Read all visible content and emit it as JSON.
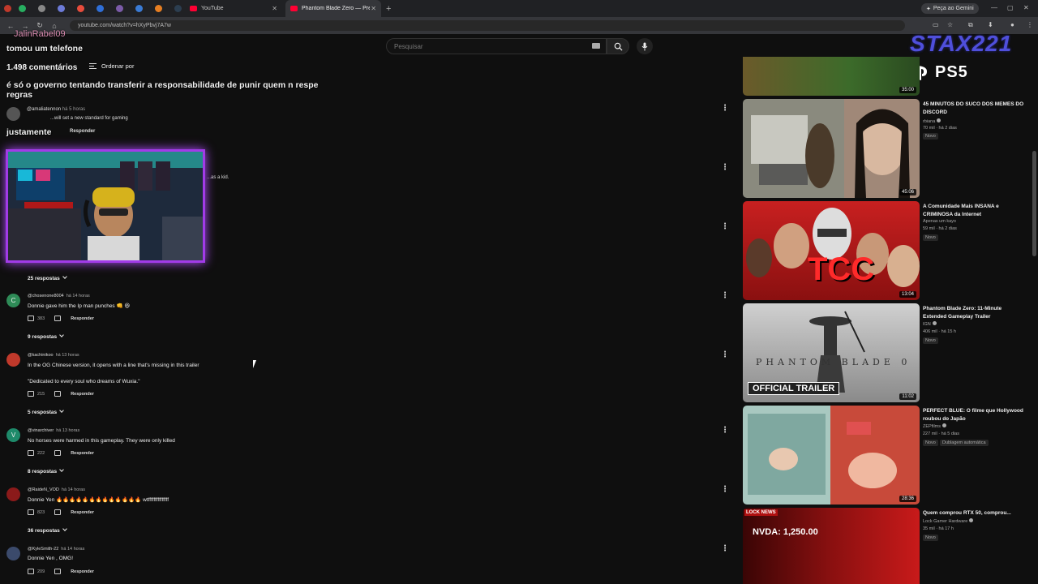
{
  "browser": {
    "tabs": [
      {
        "title": "YouTube",
        "active": false
      },
      {
        "title": "Phantom Blade Zero — Pre-Or",
        "active": true
      }
    ],
    "gemini_label": "Peça ao Gemini",
    "url": "youtube.com/watch?v=hXyPbvj7A7w",
    "new_tab": "+"
  },
  "header": {
    "search_placeholder": "Pesquisar"
  },
  "comments_header": {
    "count": "1.498 comentários",
    "sort_label": "Ordenar por"
  },
  "overlay": {
    "chat_name": "JalinRabel09",
    "chat_lines": [
      "tomou um telefone",
      "é só o governo tentando transferir a responsabilidade de punir quem n respe",
      "regras",
      "justamente"
    ],
    "ghost_author": "@amaliatennon",
    "ghost_time": "há 5 horas",
    "ghost_text": "...will set a new standard for gaming",
    "ghost_reply": "Responder",
    "ghost_kid": "...as a kid.",
    "logo_text": "STAX221",
    "console_text": "PS5"
  },
  "comments": [
    {
      "replies": "25 respostas"
    },
    {
      "author": "@chosenone8004",
      "time": "há 14 horas",
      "text": "Donnie gave him the Ip man punches 👊 😆",
      "likes": "383",
      "reply": "Responder",
      "replies": "9 respostas",
      "avatar_color": "#2e8b57",
      "avatar_letter": "C"
    },
    {
      "author": "@kachinikoo",
      "time": "há 13 horas",
      "text": "In the OG Chinese version, it opens with a line that's missing in this trailer",
      "text2": "\"Dedicated to every soul who dreams of Wuxia.\"",
      "likes": "215",
      "reply": "Responder",
      "replies": "5 respostas",
      "avatar_color": "#c0392b"
    },
    {
      "author": "@vinarchiver",
      "time": "há 13 horas",
      "text": "No horses were harmed in this gameplay. They were only killed",
      "likes": "222",
      "reply": "Responder",
      "replies": "8 respostas",
      "avatar_color": "#1e8a6a",
      "avatar_letter": "V"
    },
    {
      "author": "@RaideN_VOD",
      "time": "há 14 horas",
      "text": "Donnie Yen 🔥🔥🔥🔥🔥🔥🔥🔥🔥🔥🔥🔥🔥 wtfffffffffffffff",
      "likes": "823",
      "reply": "Responder",
      "replies": "36 respostas",
      "avatar_color": "#8b1a1a"
    },
    {
      "author": "@KyleSmith-22",
      "time": "há 14 horas",
      "text": "Donnie Yen , OMG!",
      "likes": "209",
      "reply": "Responder",
      "avatar_color": "#3b4a6b"
    }
  ],
  "recommendations": [
    {
      "duration": "35:00",
      "colors": [
        "#6b5a2a",
        "#3c6b2a"
      ]
    },
    {
      "title": "45 MINUTOS DO SUCO DOS MEMES DO DISCORD",
      "channel": "rbiana",
      "meta": "70 mil · há 2 dias",
      "badge": "Novo",
      "duration": "45:06",
      "colors": [
        "#7a7a6a",
        "#5a4a3a"
      ]
    },
    {
      "title": "A Comunidade Mais INSANA e CRIMINOSA da Internet",
      "channel": "Apenas um kayo",
      "meta": "59 mil · há 2 dias",
      "badge": "Novo",
      "duration": "13:04",
      "colors": [
        "#b81d1d",
        "#7a1010"
      ],
      "overlay_text": "TCC"
    },
    {
      "title": "Phantom Blade Zero: 11-Minute Extended Gameplay Trailer",
      "channel": "IGN",
      "meta": "406 mil · há 15 h",
      "badge": "Novo",
      "duration": "11:02",
      "colors": [
        "#bcbcbc",
        "#8a8a8a"
      ],
      "overlay_text": "PHANTOM BLADE 0",
      "overlay_banner": "OFFICIAL TRAILER"
    },
    {
      "title": "PERFECT BLUE: O filme que Hollywood roubou do Japão",
      "channel": "ZEPfilms",
      "meta": "227 mil · há 5 dias",
      "badge": "Novo",
      "badge2": "Dublagem automática",
      "duration": "28:36",
      "colors": [
        "#9ab8b0",
        "#c64a3a"
      ]
    },
    {
      "title": "Quem comprou RTX 50, comprou...",
      "channel": "Lock Gamer Hardware",
      "meta": "35 mil · há 17 h",
      "badge": "Novo",
      "duration": "",
      "colors": [
        "#5a0a0a",
        "#c81a1a"
      ],
      "overlay_text": "NVDA: 1,250.00",
      "logo": "LOCK NEWS"
    }
  ]
}
